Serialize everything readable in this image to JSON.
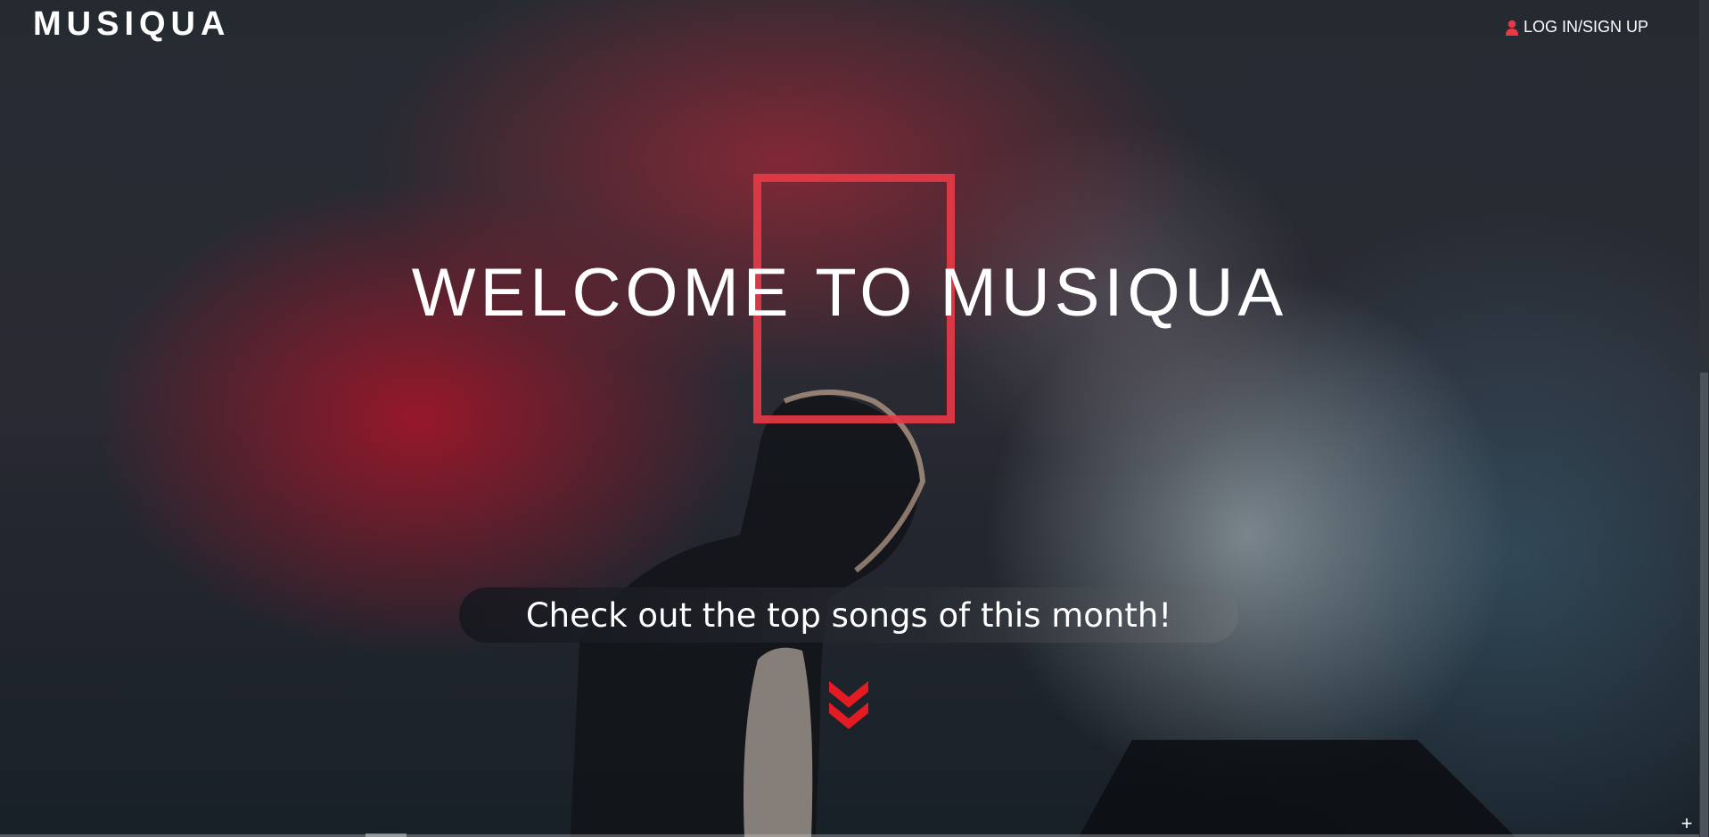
{
  "header": {
    "logo": "MUSIQUA",
    "login_label": "LOG IN/SIGN UP",
    "login_icon": "user-icon"
  },
  "hero": {
    "title": "WELCOME TO MUSIQUA",
    "banner_text": "Check out the top songs of this month!",
    "scroll_icon": "double-chevron-down-icon"
  },
  "colors": {
    "accent": "#e31b23",
    "frame": "#e83a46",
    "text": "#ffffff"
  }
}
